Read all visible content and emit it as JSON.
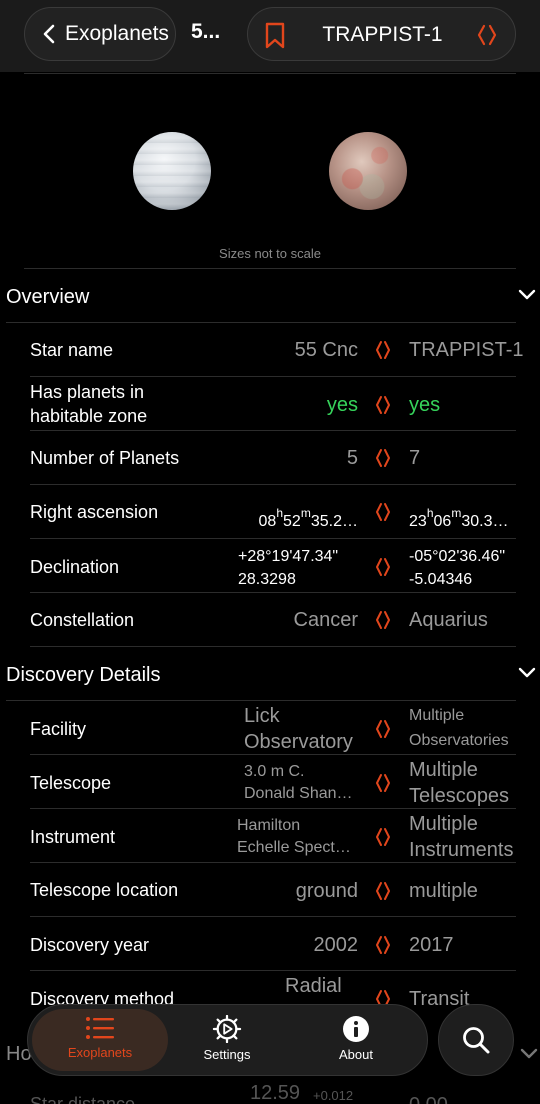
{
  "nav": {
    "back_label": "Exoplanets",
    "title_truncated": "5...",
    "compare_name": "TRAPPIST-1"
  },
  "images": {
    "note": "Sizes not to scale"
  },
  "overview": {
    "title": "Overview",
    "rows": [
      {
        "label": "Star name",
        "v1": "55 Cnc",
        "v2": "TRAPPIST-1"
      },
      {
        "label": "Has planets in habitable zone",
        "v1": "yes",
        "v2": "yes"
      },
      {
        "label": "Number of Planets",
        "v1": "5",
        "v2": "7"
      },
      {
        "label": "Right ascension",
        "v1": "08h52m35.2…",
        "v2": "23h06m30.3…"
      },
      {
        "label": "Declination",
        "v1_line1": "+28°19'47.34\"",
        "v1_line2": "28.3298",
        "v2_line1": "-05°02'36.46\"",
        "v2_line2": "-5.04346"
      },
      {
        "label": "Constellation",
        "v1": "Cancer",
        "v2": "Aquarius"
      }
    ]
  },
  "discovery": {
    "title": "Discovery Details",
    "rows": [
      {
        "label": "Facility",
        "v1_line1": "Lick",
        "v1_line2": "Observatory",
        "v2_line1": "Multiple",
        "v2_line2": "Observatories"
      },
      {
        "label": "Telescope",
        "v1_line1": "3.0 m C.",
        "v1_line2": "Donald Shan…",
        "v2_line1": "Multiple",
        "v2_line2": "Telescopes"
      },
      {
        "label": "Instrument",
        "v1_line1": "Hamilton",
        "v1_line2": "Echelle Spect…",
        "v2_line1": "Multiple",
        "v2_line2": "Instruments"
      },
      {
        "label": "Telescope location",
        "v1": "ground",
        "v2": "multiple"
      },
      {
        "label": "Discovery year",
        "v1": "2002",
        "v2": "2017"
      },
      {
        "label": "Discovery method",
        "v1": "Radial",
        "v2": "Transit"
      }
    ]
  },
  "under_tabbar": {
    "section_fragment": "Ho",
    "row_label": "Star distance",
    "v1": "12.59",
    "v1_delta": "+0.012",
    "v2": "0.00"
  },
  "tabbar": {
    "tabs": [
      {
        "label": "Exoplanets",
        "icon": "list-icon",
        "active": true
      },
      {
        "label": "Settings",
        "icon": "settings-gear-icon",
        "active": false
      },
      {
        "label": "About",
        "icon": "info-icon",
        "active": false
      }
    ],
    "search_icon": "search-icon"
  },
  "colors": {
    "accent": "#e2461c",
    "positive": "#36d35b",
    "value": "#9a9a9a",
    "background": "#000000"
  }
}
